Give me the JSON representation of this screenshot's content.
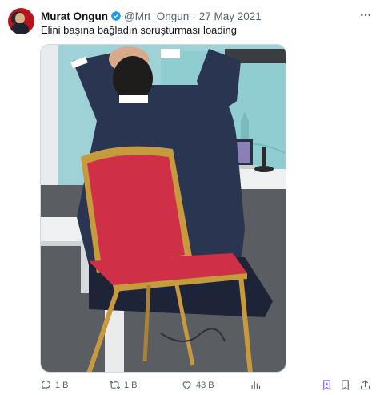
{
  "tweet": {
    "author_name": "Murat Ongun",
    "handle": "@Mrt_Ongun",
    "separator": "·",
    "date": "27 May 2021",
    "text": "Elini başına bağladın soruşturması loading"
  },
  "actions": {
    "reply_count": "1 B",
    "retweet_count": "1 B",
    "like_count": "43 B"
  },
  "colors": {
    "verified": "#1d9bf0",
    "bookmark_active": "#7856ff",
    "secondary_text": "#536471"
  },
  "icons": [
    "more-icon",
    "verified-icon",
    "reply-icon",
    "retweet-icon",
    "like-icon",
    "views-icon",
    "bookmark-icon",
    "share-icon"
  ]
}
